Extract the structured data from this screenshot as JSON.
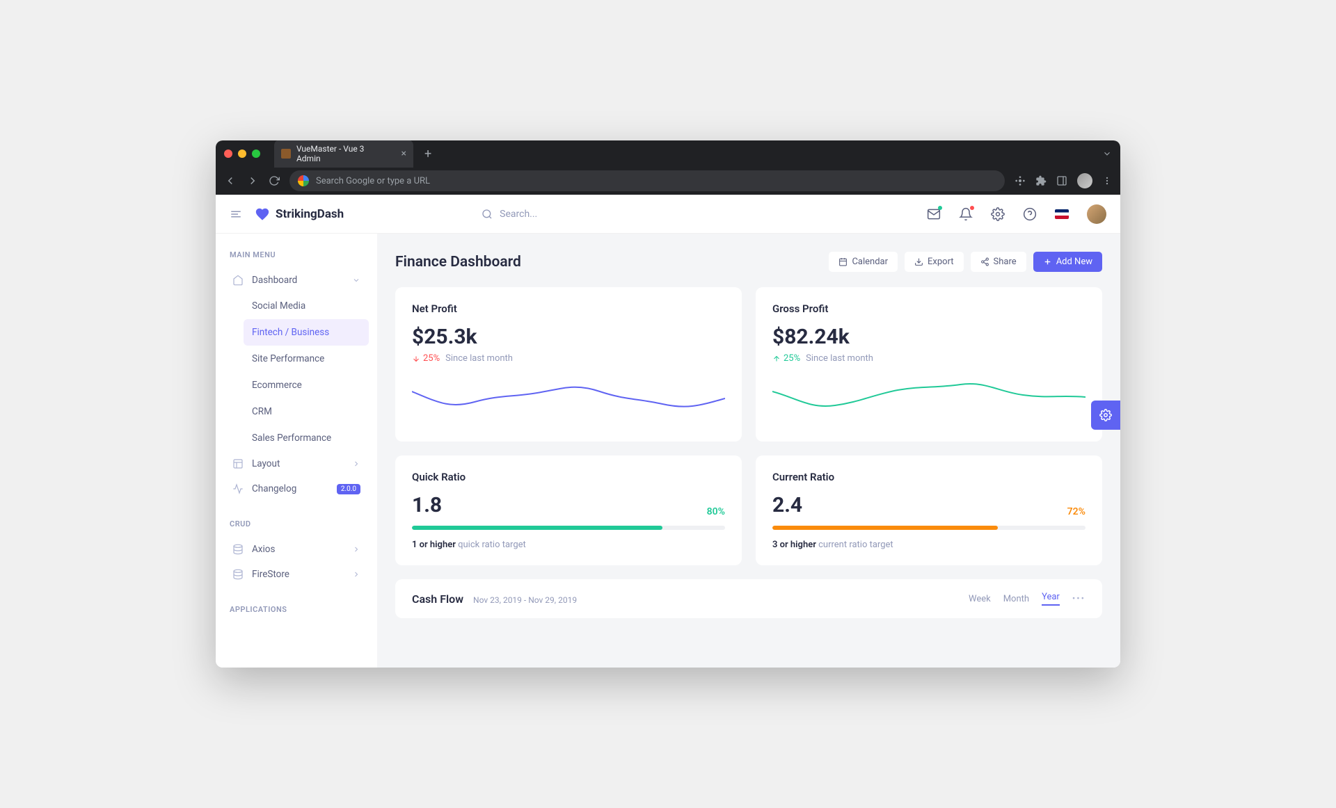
{
  "browser": {
    "tab_title": "VueMaster - Vue 3 Admin",
    "url_placeholder": "Search Google or type a URL"
  },
  "header": {
    "brand": "StrikingDash",
    "search_placeholder": "Search..."
  },
  "sidebar": {
    "section_main": "MAIN MENU",
    "dashboard": "Dashboard",
    "sub": {
      "social": "Social Media",
      "fintech": "Fintech / Business",
      "site": "Site Performance",
      "ecom": "Ecommerce",
      "crm": "CRM",
      "sales": "Sales Performance"
    },
    "layout": "Layout",
    "changelog": "Changelog",
    "changelog_badge": "2.0.0",
    "section_crud": "CRUD",
    "axios": "Axios",
    "firestore": "FireStore",
    "section_apps": "APPLICATIONS"
  },
  "page": {
    "title": "Finance Dashboard",
    "actions": {
      "calendar": "Calendar",
      "export": "Export",
      "share": "Share",
      "add_new": "Add New"
    }
  },
  "cards": {
    "net_profit": {
      "title": "Net Profit",
      "value": "$25.3k",
      "change": "25%",
      "since": "Since last month",
      "direction": "down"
    },
    "gross_profit": {
      "title": "Gross Profit",
      "value": "$82.24k",
      "change": "25%",
      "since": "Since last month",
      "direction": "up"
    },
    "quick_ratio": {
      "title": "Quick Ratio",
      "value": "1.8",
      "percent": "80%",
      "target_bold": "1 or higher",
      "target_muted": "quick ratio target"
    },
    "current_ratio": {
      "title": "Current Ratio",
      "value": "2.4",
      "percent": "72%",
      "target_bold": "3 or higher",
      "target_muted": "current ratio target"
    }
  },
  "cashflow": {
    "title": "Cash Flow",
    "range": "Nov 23, 2019 - Nov 29, 2019",
    "tabs": {
      "week": "Week",
      "month": "Month",
      "year": "Year"
    }
  },
  "chart_data": [
    {
      "type": "line",
      "title": "Net Profit",
      "series": [
        {
          "name": "Net Profit",
          "values": [
            60,
            35,
            50,
            45,
            65,
            60,
            80,
            70,
            55,
            45,
            60,
            50
          ]
        }
      ],
      "x": [
        1,
        2,
        3,
        4,
        5,
        6,
        7,
        8,
        9,
        10,
        11,
        12
      ],
      "ylim": [
        0,
        100
      ],
      "color": "#5f63f2"
    },
    {
      "type": "line",
      "title": "Gross Profit",
      "series": [
        {
          "name": "Gross Profit",
          "values": [
            60,
            40,
            30,
            40,
            55,
            65,
            60,
            55,
            75,
            65,
            50,
            55
          ]
        }
      ],
      "x": [
        1,
        2,
        3,
        4,
        5,
        6,
        7,
        8,
        9,
        10,
        11,
        12
      ],
      "ylim": [
        0,
        100
      ],
      "color": "#20c997"
    },
    {
      "type": "bar",
      "title": "Quick Ratio",
      "categories": [
        "progress"
      ],
      "values": [
        80
      ],
      "ylim": [
        0,
        100
      ],
      "color": "#20c997"
    },
    {
      "type": "bar",
      "title": "Current Ratio",
      "categories": [
        "progress"
      ],
      "values": [
        72
      ],
      "ylim": [
        0,
        100
      ],
      "color": "#fa8b0c"
    }
  ]
}
